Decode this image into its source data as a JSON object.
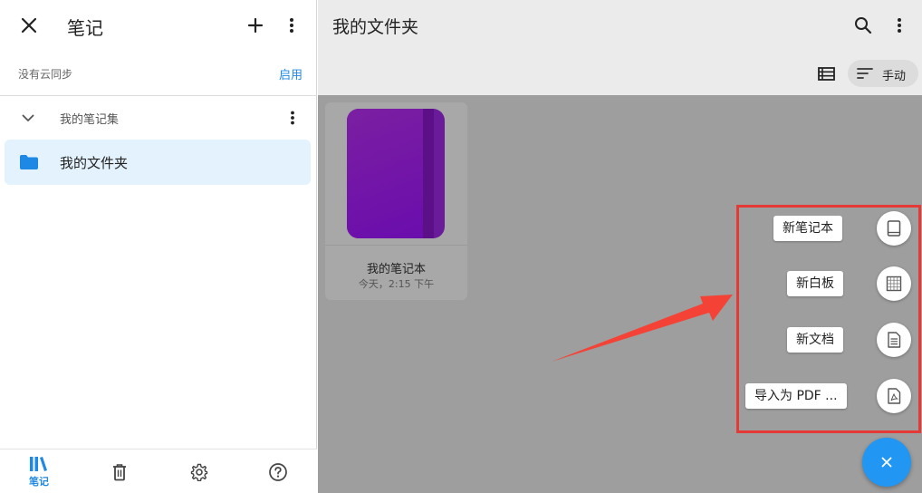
{
  "left_panel": {
    "title": "笔记",
    "close_icon": "close-icon",
    "add_icon": "plus-icon",
    "more_icon": "more-vert-icon",
    "sync": {
      "status_text": "没有云同步",
      "enable_label": "启用"
    },
    "notebook_collection": {
      "label": "我的笔记集",
      "expand_icon": "chevron-down-icon"
    },
    "folders": [
      {
        "label": "我的文件夹",
        "icon": "folder-icon",
        "selected": true
      }
    ],
    "bottom_nav": [
      {
        "label": "笔记",
        "icon": "library-icon",
        "active": true
      },
      {
        "label": "",
        "icon": "trash-icon",
        "active": false
      },
      {
        "label": "",
        "icon": "gear-icon",
        "active": false
      },
      {
        "label": "",
        "icon": "help-icon",
        "active": false
      }
    ]
  },
  "right_panel": {
    "title": "我的文件夹",
    "search_icon": "search-icon",
    "more_icon": "more-vert-icon",
    "toolbar": {
      "view_icon": "list-view-icon",
      "sort_icon": "sort-icon",
      "sort_label": "手动"
    },
    "notebooks": [
      {
        "name": "我的笔记本",
        "date": "今天，2:15 下午",
        "cover_color": "#6a1b9a"
      }
    ],
    "fab_menu": {
      "items": [
        {
          "label": "新笔记本",
          "icon": "notebook-icon"
        },
        {
          "label": "新白板",
          "icon": "whiteboard-grid-icon"
        },
        {
          "label": "新文档",
          "icon": "document-icon"
        },
        {
          "label": "导入为 PDF ...",
          "icon": "pdf-file-icon"
        }
      ],
      "close_icon": "close-icon",
      "highlight_color": "#e53935",
      "fab_color": "#2196f3"
    }
  },
  "colors": {
    "accent": "#1e88e5",
    "selected_bg": "#e3f2fd",
    "scrim": "#9e9e9e",
    "header_bg": "#ebebeb"
  }
}
